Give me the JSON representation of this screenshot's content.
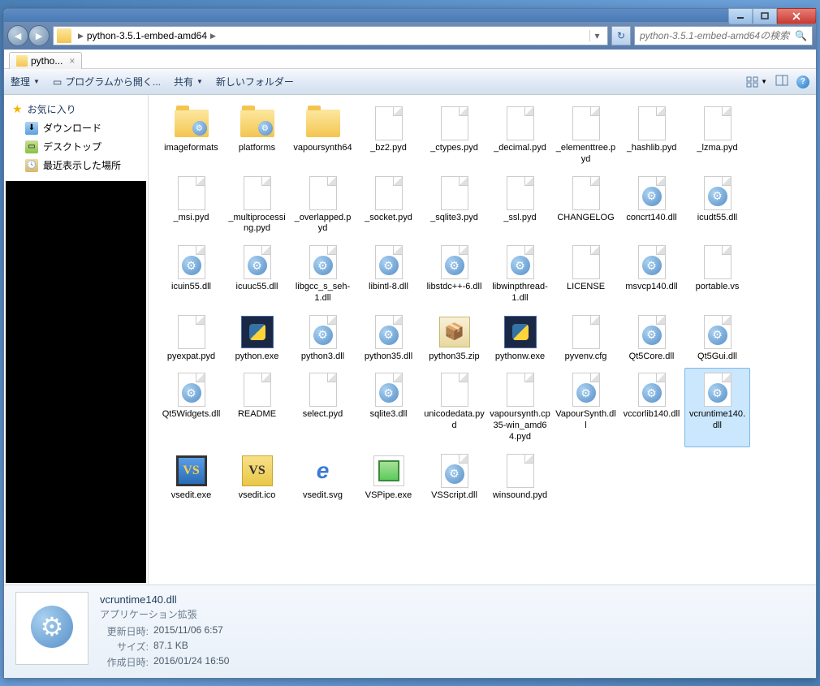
{
  "breadcrumb": {
    "path": "python-3.5.1-embed-amd64",
    "arrow": "▶"
  },
  "search": {
    "placeholder": "python-3.5.1-embed-amd64の検索"
  },
  "tab": {
    "label": "pytho...",
    "close": "×"
  },
  "toolbar": {
    "organize": "整理",
    "open_with": "プログラムから開く...",
    "share": "共有",
    "new_folder": "新しいフォルダー"
  },
  "sidebar": {
    "favorites": "お気に入り",
    "downloads": "ダウンロード",
    "desktop": "デスクトップ",
    "recent": "最近表示した場所"
  },
  "files": [
    {
      "name": "imageformats",
      "type": "folder-gear"
    },
    {
      "name": "platforms",
      "type": "folder-gear"
    },
    {
      "name": "vapoursynth64",
      "type": "folder"
    },
    {
      "name": "_bz2.pyd",
      "type": "file"
    },
    {
      "name": "_ctypes.pyd",
      "type": "file"
    },
    {
      "name": "_decimal.pyd",
      "type": "file"
    },
    {
      "name": "_elementtree.pyd",
      "type": "file"
    },
    {
      "name": "_hashlib.pyd",
      "type": "file"
    },
    {
      "name": "_lzma.pyd",
      "type": "file"
    },
    {
      "name": "_msi.pyd",
      "type": "file"
    },
    {
      "name": "_multiprocessing.pyd",
      "type": "file"
    },
    {
      "name": "_overlapped.pyd",
      "type": "file"
    },
    {
      "name": "_socket.pyd",
      "type": "file"
    },
    {
      "name": "_sqlite3.pyd",
      "type": "file"
    },
    {
      "name": "_ssl.pyd",
      "type": "file"
    },
    {
      "name": "CHANGELOG",
      "type": "file"
    },
    {
      "name": "concrt140.dll",
      "type": "dll"
    },
    {
      "name": "icudt55.dll",
      "type": "dll"
    },
    {
      "name": "icuin55.dll",
      "type": "dll"
    },
    {
      "name": "icuuc55.dll",
      "type": "dll"
    },
    {
      "name": "libgcc_s_seh-1.dll",
      "type": "dll"
    },
    {
      "name": "libintl-8.dll",
      "type": "dll"
    },
    {
      "name": "libstdc++-6.dll",
      "type": "dll"
    },
    {
      "name": "libwinpthread-1.dll",
      "type": "dll"
    },
    {
      "name": "LICENSE",
      "type": "file"
    },
    {
      "name": "msvcp140.dll",
      "type": "dll"
    },
    {
      "name": "portable.vs",
      "type": "file"
    },
    {
      "name": "pyexpat.pyd",
      "type": "file"
    },
    {
      "name": "python.exe",
      "type": "exe"
    },
    {
      "name": "python3.dll",
      "type": "dll"
    },
    {
      "name": "python35.dll",
      "type": "dll"
    },
    {
      "name": "python35.zip",
      "type": "zip"
    },
    {
      "name": "pythonw.exe",
      "type": "exe"
    },
    {
      "name": "pyvenv.cfg",
      "type": "file"
    },
    {
      "name": "Qt5Core.dll",
      "type": "dll"
    },
    {
      "name": "Qt5Gui.dll",
      "type": "dll"
    },
    {
      "name": "Qt5Widgets.dll",
      "type": "dll"
    },
    {
      "name": "README",
      "type": "file"
    },
    {
      "name": "select.pyd",
      "type": "file"
    },
    {
      "name": "sqlite3.dll",
      "type": "dll"
    },
    {
      "name": "unicodedata.pyd",
      "type": "file"
    },
    {
      "name": "vapoursynth.cp35-win_amd64.pyd",
      "type": "file"
    },
    {
      "name": "VapourSynth.dll",
      "type": "dll"
    },
    {
      "name": "vccorlib140.dll",
      "type": "dll"
    },
    {
      "name": "vcruntime140.dll",
      "type": "dll",
      "selected": true
    },
    {
      "name": "vsedit.exe",
      "type": "vs"
    },
    {
      "name": "vsedit.ico",
      "type": "vsico"
    },
    {
      "name": "vsedit.svg",
      "type": "ie"
    },
    {
      "name": "VSPipe.exe",
      "type": "svg"
    },
    {
      "name": "VSScript.dll",
      "type": "dll"
    },
    {
      "name": "winsound.pyd",
      "type": "file"
    }
  ],
  "details": {
    "name": "vcruntime140.dll",
    "type_label": "アプリケーション拡張",
    "rows": [
      {
        "label": "更新日時:",
        "value": "2015/11/06 6:57"
      },
      {
        "label": "サイズ:",
        "value": "87.1 KB"
      },
      {
        "label": "作成日時:",
        "value": "2016/01/24 16:50"
      }
    ]
  }
}
